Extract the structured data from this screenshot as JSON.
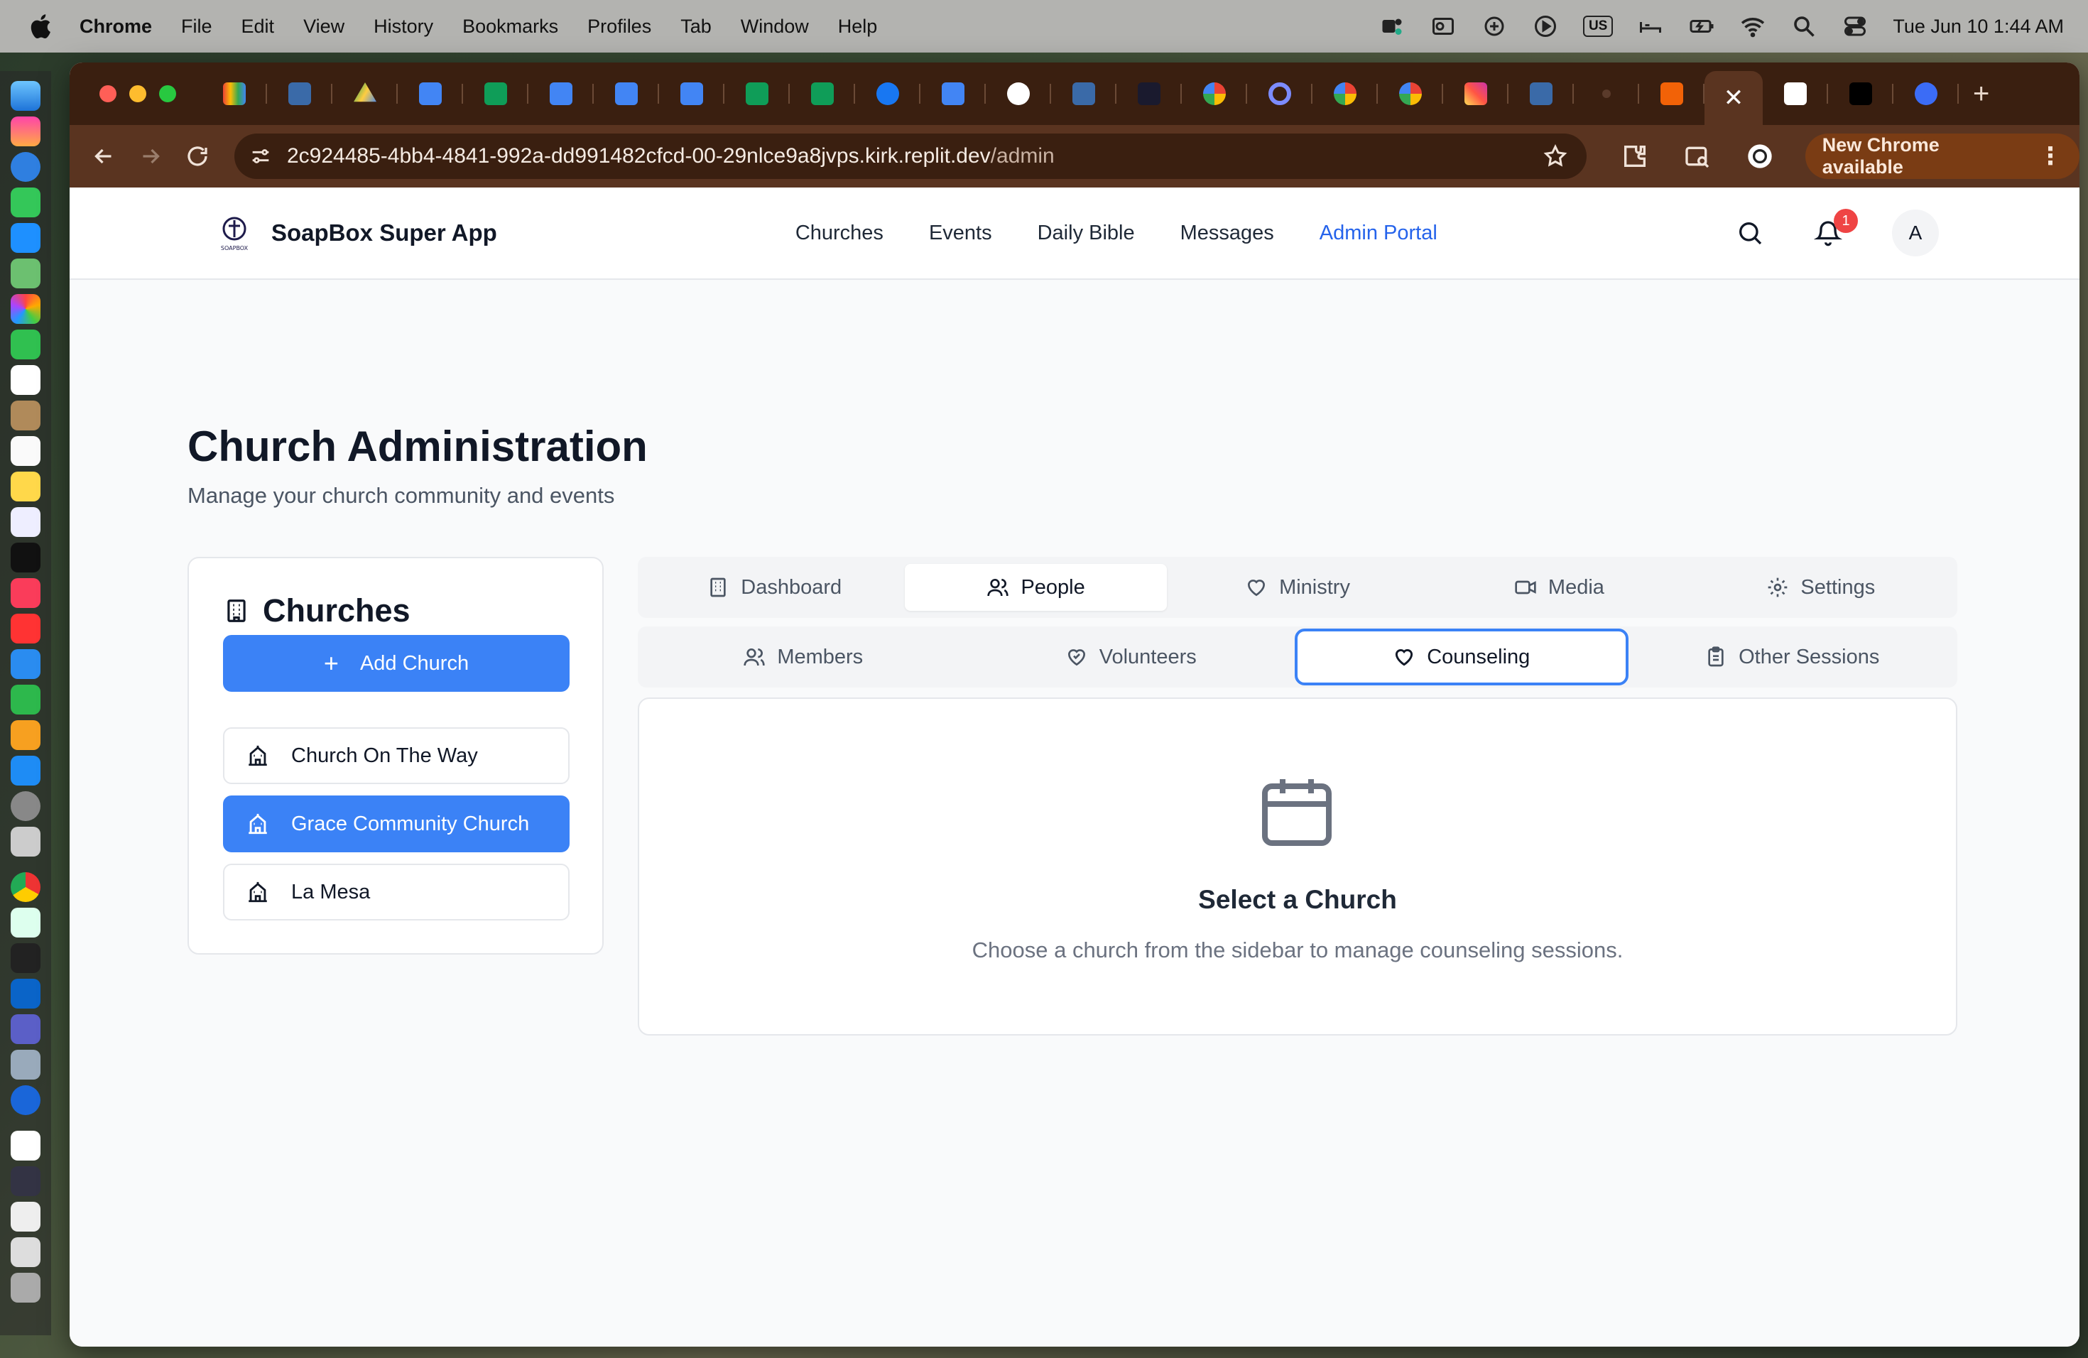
{
  "menubar": {
    "app_name": "Chrome",
    "items": [
      "File",
      "Edit",
      "View",
      "History",
      "Bookmarks",
      "Profiles",
      "Tab",
      "Window",
      "Help"
    ],
    "input_source": "US",
    "clock": "Tue Jun 10  1:44 AM"
  },
  "browser": {
    "url_host": "2c924485-4bb4-4841-992a-dd991482cfcd-00-29nlce9a8jvps.kirk.replit.dev",
    "url_path": "/admin",
    "update_label": "New Chrome available",
    "active_tab_close": "✕",
    "new_tab": "+"
  },
  "header": {
    "brand": "SoapBox Super App",
    "logo_text": "SOAPBOX",
    "nav": [
      "Churches",
      "Events",
      "Daily Bible",
      "Messages",
      "Admin Portal"
    ],
    "notification_count": "1",
    "avatar_initial": "A"
  },
  "page": {
    "title": "Church Administration",
    "subtitle": "Manage your church community and events"
  },
  "sidebar": {
    "title": "Churches",
    "add_label": "Add Church",
    "churches": [
      "Church On The Way",
      "Grace Community Church",
      "La Mesa"
    ],
    "selected_index": 1
  },
  "tabs_primary": [
    "Dashboard",
    "People",
    "Ministry",
    "Media",
    "Settings"
  ],
  "tabs_secondary": [
    "Members",
    "Volunteers",
    "Counseling",
    "Other Sessions"
  ],
  "empty_state": {
    "title": "Select a Church",
    "description": "Choose a church from the sidebar to manage counseling sessions."
  },
  "colors": {
    "accent": "#3b82f6",
    "nav_active": "#2563eb",
    "badge": "#ef4444"
  }
}
